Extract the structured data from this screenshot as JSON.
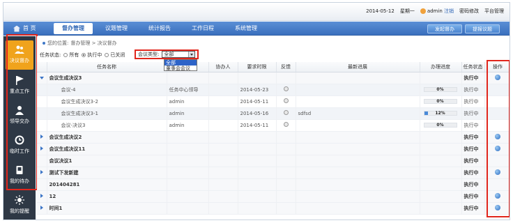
{
  "topbar": {
    "date": "2014-05-12",
    "weekday": "星期一",
    "user": "admin",
    "logout": "注销",
    "change_password": "密码修改",
    "platform_manage": "平台管理"
  },
  "nav": {
    "home": "首  页",
    "tabs": [
      "督办管理",
      "议题管理",
      "统计报告",
      "工作日程",
      "系统管理"
    ],
    "active_tab": 0,
    "buttons": {
      "start_supervise": "发起督办",
      "submit_topic": "提报议题"
    }
  },
  "sidebar": {
    "items": [
      {
        "label": "决议督办",
        "icon": "users-icon",
        "active": true
      },
      {
        "label": "重点工作",
        "icon": "flag-icon",
        "active": false
      },
      {
        "label": "领导交办",
        "icon": "person-icon",
        "active": false
      },
      {
        "label": "临时工作",
        "icon": "clock-icon",
        "active": false
      },
      {
        "label": "我的待办",
        "icon": "book-icon",
        "active": false
      },
      {
        "label": "我的提醒",
        "icon": "sun-icon",
        "active": false
      }
    ]
  },
  "breadcrumb": {
    "prefix": "您的位置:",
    "path": "督办管理 > 决议督办"
  },
  "filter": {
    "status_label": "任务状态:",
    "status_options": [
      "所有",
      "执行中",
      "已关闭"
    ],
    "status_selected": 1,
    "type_label": "会议类型:",
    "type_selected": "全部",
    "type_options": [
      "全部",
      "董事会会议"
    ]
  },
  "table": {
    "headers": [
      "任务名称",
      "承办人",
      "协办人",
      "要求时限",
      "反馈",
      "最新进展",
      "办理进度",
      "任务状态",
      "操作"
    ],
    "rows": [
      {
        "kind": "parent",
        "expanded": true,
        "name": "会议生成决议3",
        "undertaker": "",
        "deadline": "",
        "feedback": false,
        "latest": "",
        "progress": null,
        "status": "执行中",
        "op": true
      },
      {
        "kind": "child",
        "name": "会议-4",
        "undertaker": "任务中心领导",
        "deadline": "2014-05-23",
        "feedback": true,
        "latest": "",
        "progress": 0,
        "progress_text": "0%",
        "status": "执行中",
        "op": false
      },
      {
        "kind": "child",
        "name": "会议生成决议3-2",
        "undertaker": "admin",
        "deadline": "2014-05-11",
        "feedback": true,
        "latest": "",
        "progress": 0,
        "progress_text": "0%",
        "status": "执行中",
        "op": false
      },
      {
        "kind": "child",
        "name": "会议生成决议3-1",
        "undertaker": "admin",
        "deadline": "2014-05-16",
        "feedback": true,
        "latest": "sdfsd",
        "progress": 12,
        "progress_text": "12%",
        "status": "执行中",
        "op": false
      },
      {
        "kind": "child",
        "name": "会议-决议3",
        "undertaker": "admin",
        "deadline": "2014-05-11",
        "feedback": true,
        "latest": "",
        "progress": 0,
        "progress_text": "0%",
        "status": "执行中",
        "op": false
      },
      {
        "kind": "parent",
        "expanded": false,
        "name": "会议生成决议2",
        "undertaker": "",
        "deadline": "",
        "feedback": false,
        "latest": "",
        "progress": null,
        "status": "执行中",
        "op": true
      },
      {
        "kind": "parent",
        "expanded": false,
        "name": "会议生成决议11",
        "undertaker": "",
        "deadline": "",
        "feedback": false,
        "latest": "",
        "progress": null,
        "status": "执行中",
        "op": true
      },
      {
        "kind": "parent",
        "expanded": null,
        "name": "会议决议1",
        "undertaker": "",
        "deadline": "",
        "feedback": false,
        "latest": "",
        "progress": null,
        "status": "执行中",
        "op": false
      },
      {
        "kind": "parent",
        "expanded": false,
        "name": "测试下发新建",
        "undertaker": "",
        "deadline": "",
        "feedback": false,
        "latest": "",
        "progress": null,
        "status": "执行中",
        "op": true
      },
      {
        "kind": "parent",
        "expanded": null,
        "name": "201404281",
        "undertaker": "",
        "deadline": "",
        "feedback": false,
        "latest": "",
        "progress": null,
        "status": "执行中",
        "op": false
      },
      {
        "kind": "parent",
        "expanded": false,
        "name": "12",
        "undertaker": "",
        "deadline": "",
        "feedback": false,
        "latest": "",
        "progress": null,
        "status": "执行中",
        "op": true
      },
      {
        "kind": "parent",
        "expanded": false,
        "name": "时间1",
        "undertaker": "",
        "deadline": "",
        "feedback": false,
        "latest": "",
        "progress": null,
        "status": "执行中",
        "op": true
      }
    ]
  }
}
